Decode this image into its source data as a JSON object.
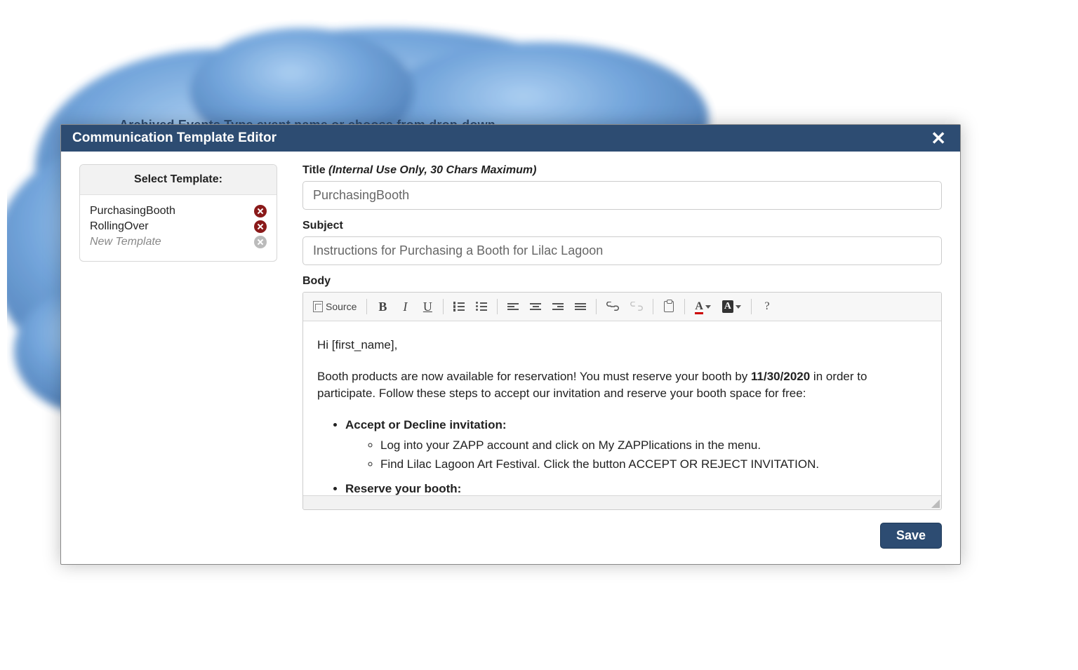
{
  "background": {
    "hint_text": "Archived Events Type event name or choose from drop-down"
  },
  "modal": {
    "title": "Communication Template Editor",
    "close_glyph": "✕"
  },
  "sidebar": {
    "header": "Select Template:",
    "templates": [
      {
        "name": "PurchasingBooth",
        "is_new": false
      },
      {
        "name": "RollingOver",
        "is_new": false
      },
      {
        "name": "New Template",
        "is_new": true
      }
    ]
  },
  "form": {
    "title_label": "Title ",
    "title_hint": "(Internal Use Only, 30 Chars Maximum)",
    "title_value": "PurchasingBooth",
    "subject_label": "Subject",
    "subject_value": "Instructions for Purchasing a Booth for Lilac Lagoon",
    "body_label": "Body"
  },
  "toolbar": {
    "source_label": "Source",
    "help_glyph": "?"
  },
  "body_content": {
    "greeting": "Hi [first_name],",
    "intro_pre": "Booth products are now available for reservation! You must reserve your booth by ",
    "deadline": "11/30/2020",
    "intro_post": " in order to participate. Follow these steps to accept our invitation and reserve your booth space for free:",
    "step1_title": "Accept or Decline invitation:",
    "step1_items": [
      "Log into your ZAPP account and click on My ZAPPlications in the menu.",
      "Find Lilac Lagoon Art Festival. Click the button ACCEPT OR REJECT INVITATION."
    ],
    "step2_title": "Reserve your booth:"
  },
  "actions": {
    "save_label": "Save"
  },
  "colors": {
    "primary": "#2d4c72",
    "delete_icon": "#8a1a1a"
  }
}
